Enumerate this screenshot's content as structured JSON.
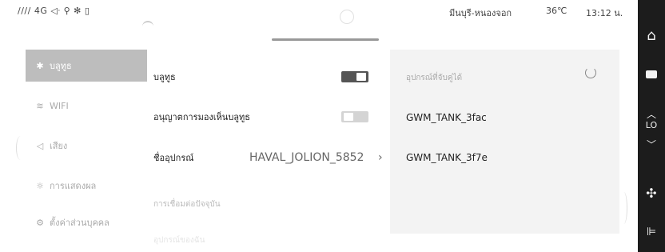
{
  "status_bar": {
    "left_indicators": "//// 4G  ◁ᐧ  ⚲  ✻  ▯",
    "location": "มีนบุรี-หนองจอก",
    "temperature": "36℃",
    "time": "13:12 น."
  },
  "sidebar": {
    "items": [
      {
        "icon": "bluetooth-icon",
        "glyph": "✱",
        "label": "บลูทูธ"
      },
      {
        "icon": "wifi-icon",
        "glyph": "≋",
        "label": "WIFI"
      },
      {
        "icon": "sound-icon",
        "glyph": "◁",
        "label": "เสียง"
      },
      {
        "icon": "display-icon",
        "glyph": "☼",
        "label": "การแสดงผล"
      },
      {
        "icon": "personal-settings-icon",
        "glyph": "⚙",
        "label": "ตั้งค่าส่วนบุคคล"
      }
    ]
  },
  "main": {
    "bluetooth_label": "บลูทูธ",
    "bluetooth_on": true,
    "visibility_label": "อนุญาตการมองเห็นบลูทูธ",
    "visibility_on": false,
    "device_name_label": "ชื่ออุปกรณ์",
    "device_name_value": "HAVAL_JOLION_5852",
    "chevron": "›",
    "current_connection_label": "การเชื่อมต่อปัจจุบัน",
    "faint_next_label": "อุปกรณ์ของฉัน"
  },
  "right_panel": {
    "title": "อุปกรณ์ที่จับคู่ได้",
    "devices": [
      "GWM_TANK_3fac",
      "GWM_TANK_3f7e"
    ]
  },
  "right_strip": {
    "home": "⌂",
    "up": "︿",
    "level": "LO",
    "down": "﹀",
    "fan": "✣",
    "seat": "⊫"
  },
  "colors": {
    "strip_bg": "#1c1c1c",
    "active_item_bg": "#bdbdbd",
    "panel_bg": "#f3f3f3",
    "toggle_on": "#555555",
    "toggle_off": "#d4d4d4"
  }
}
